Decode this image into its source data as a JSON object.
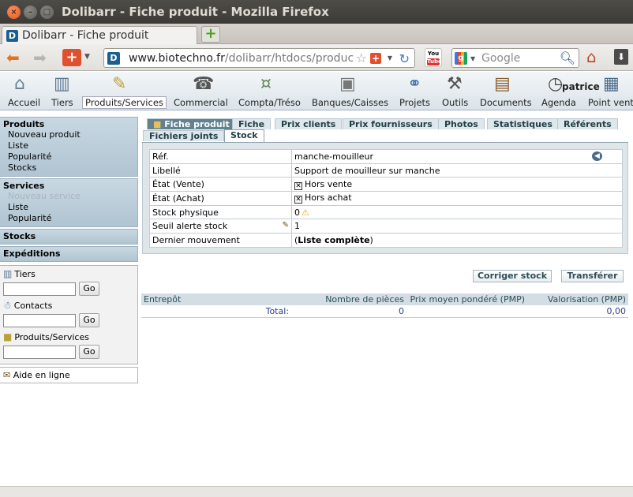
{
  "window": {
    "title": "Dolibarr - Fiche produit - Mozilla Firefox"
  },
  "browser": {
    "tab_title": "Dolibarr - Fiche produit",
    "url_host": "www.biotechno.fr",
    "url_path": "/dolibarr/htdocs/produc",
    "search_placeholder": "Google"
  },
  "topmenu": {
    "user": "patrice",
    "items": [
      {
        "label": "Accueil",
        "icon": "home-icon"
      },
      {
        "label": "Tiers",
        "icon": "building-icon"
      },
      {
        "label": "Produits/Services",
        "icon": "product-icon"
      },
      {
        "label": "Commercial",
        "icon": "commercial-icon"
      },
      {
        "label": "Compta/Tréso",
        "icon": "money-icon"
      },
      {
        "label": "Banques/Caisses",
        "icon": "safe-icon"
      },
      {
        "label": "Projets",
        "icon": "project-icon"
      },
      {
        "label": "Outils",
        "icon": "tools-icon"
      },
      {
        "label": "Documents",
        "icon": "documents-icon"
      },
      {
        "label": "Agenda",
        "icon": "clock-icon"
      },
      {
        "label": "Point vente",
        "icon": "pos-icon"
      }
    ]
  },
  "leftmenu": {
    "produits": {
      "title": "Produits",
      "items": [
        "Nouveau produit",
        "Liste",
        "Popularité",
        "Stocks"
      ]
    },
    "services": {
      "title": "Services",
      "items": [
        "Nouveau service",
        "Liste",
        "Popularité"
      ]
    },
    "stocks": "Stocks",
    "expeditions": "Expéditions",
    "search": {
      "tiers": "Tiers",
      "contacts": "Contacts",
      "produits": "Produits/Services",
      "go": "Go"
    },
    "help": "Aide en ligne"
  },
  "tabs": {
    "fiche_produit": "Fiche produit",
    "fiche": "Fiche",
    "prix_clients": "Prix clients",
    "prix_fournisseurs": "Prix fournisseurs",
    "photos": "Photos",
    "statistiques": "Statistiques",
    "referents": "Référents",
    "fichiers_joints": "Fichiers joints",
    "stock": "Stock"
  },
  "product": {
    "ref_label": "Réf.",
    "ref": "manche-mouilleur",
    "libelle_label": "Libellé",
    "libelle": "Support de mouilleur sur manche",
    "etat_vente_label": "État (Vente)",
    "etat_vente": "Hors vente",
    "etat_achat_label": "État (Achat)",
    "etat_achat": "Hors achat",
    "stock_physique_label": "Stock physique",
    "stock_physique": "0",
    "seuil_label": "Seuil alerte stock",
    "seuil": "1",
    "dernier_label": "Dernier mouvement",
    "dernier_open": "(",
    "dernier_link": "Liste complète",
    "dernier_close": ")"
  },
  "actions": {
    "corriger": "Corriger stock",
    "transferer": "Transférer"
  },
  "warehouse": {
    "headers": [
      "Entrepôt",
      "Nombre de pièces",
      "Prix moyen pondéré (PMP)",
      "Valorisation (PMP)"
    ],
    "total_label": "Total:",
    "total_pieces": "0",
    "total_valorisation": "0,00"
  }
}
